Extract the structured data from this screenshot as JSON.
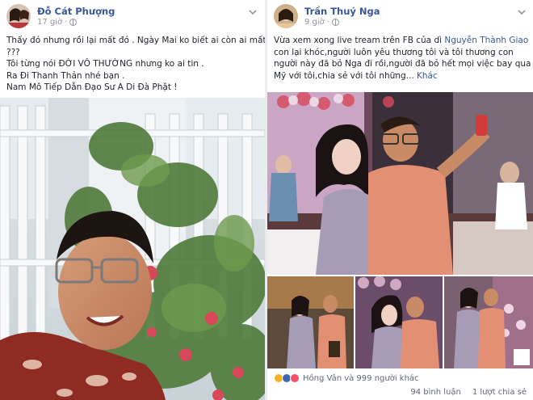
{
  "left_post": {
    "author": "Đỗ Cát Phượng",
    "time": "17 giờ",
    "lines": [
      "Thấy đó nhưng rồi lại mất đó . Ngày Mai ko biết ai còn ai mất",
      "???",
      "Tôi từng nói ĐỜI VÔ THƯỜNG nhưng ko ai tin .",
      "Ra Đi Thanh Thản nhé bạn .",
      "Nam Mô Tiếp Dẫn Đạo Sư A Di Đà Phật !"
    ]
  },
  "right_post": {
    "author": "Trần Thuý Nga",
    "time": "9 giờ",
    "line1_prefix": "Vừa xem xong live tream trên FB của dì ",
    "line1_link": "Nguyễn Thành Giao",
    "lines": [
      "con lại khóc,người luôn yêu thương tôi và tôi thương con",
      "người này đã bỏ Nga đi rồi,người đã bỏ hết mọi việc bay qua"
    ],
    "line4_prefix": "Mỹ với tôi,chia sẻ với tôi những... ",
    "more_label": "Khác",
    "reactions_text": "Hồng Vân và 999 người khác",
    "comments": "94 bình luận",
    "shares": "1 lượt chia sẻ",
    "reaction_icons": [
      "sad-icon",
      "like-icon",
      "love-icon"
    ]
  },
  "colors": {
    "link": "#365899",
    "meta": "#90949c",
    "text": "#1d2129"
  }
}
